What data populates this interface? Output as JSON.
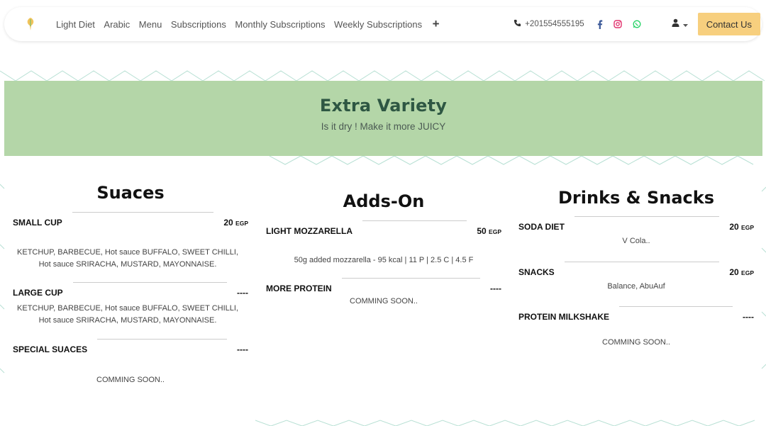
{
  "nav": {
    "logo_icon": "leaf-logo-icon",
    "links": [
      "Light Diet",
      "Arabic",
      "Menu",
      "Subscriptions",
      "Monthly Subscriptions",
      "Weekly Subscriptions"
    ],
    "more_label": "+",
    "phone": "+201554555195",
    "social_icons": [
      "facebook-icon",
      "instagram-icon",
      "whatsapp-icon"
    ],
    "user_icon": "user-icon",
    "contact_label": "Contact Us"
  },
  "hero": {
    "title": "Extra Variety",
    "subtitle": "Is it dry !  Make it more JUICY"
  },
  "colors": {
    "hero_bg": "#b4d6a8",
    "hero_title": "#2e5743",
    "contact_bg": "#f7cf7e",
    "facebook": "#3b5998",
    "instagram": "#e1306c",
    "whatsapp": "#25d366"
  },
  "sections": [
    {
      "title": "Suaces",
      "items": [
        {
          "name": "SMALL CUP",
          "price": "20",
          "currency": "EGP",
          "desc": "KETCHUP, BARBECUE, Hot sauce BUFFALO, SWEET CHILLI, Hot sauce SRIRACHA, MUSTARD, MAYONNAISE."
        },
        {
          "name": "LARGE CUP",
          "price": "----",
          "currency": "",
          "desc": "KETCHUP, BARBECUE, Hot sauce BUFFALO, SWEET CHILLI, Hot sauce SRIRACHA, MUSTARD, MAYONNAISE."
        },
        {
          "name": "SPECIAL SUACES",
          "price": "----",
          "currency": "",
          "desc": "COMMING SOON.."
        }
      ]
    },
    {
      "title": "Adds-On",
      "items": [
        {
          "name": "LIGHT MOZZARELLA",
          "price": "50",
          "currency": "EGP",
          "desc": "50g added mozzarella - 95 kcal | 11 P | 2.5 C | 4.5 F"
        },
        {
          "name": "MORE PROTEIN",
          "price": "----",
          "currency": "",
          "desc": "COMMING SOON.."
        }
      ]
    },
    {
      "title": "Drinks & Snacks",
      "items": [
        {
          "name": "SODA DIET",
          "price": "20",
          "currency": "EGP",
          "desc": "V Cola.."
        },
        {
          "name": "SNACKS",
          "price": "20",
          "currency": "EGP",
          "desc": "Balance, AbuAuf"
        },
        {
          "name": "PROTEIN MILKSHAKE",
          "price": "----",
          "currency": "",
          "desc": "COMMING SOON.."
        }
      ]
    }
  ]
}
